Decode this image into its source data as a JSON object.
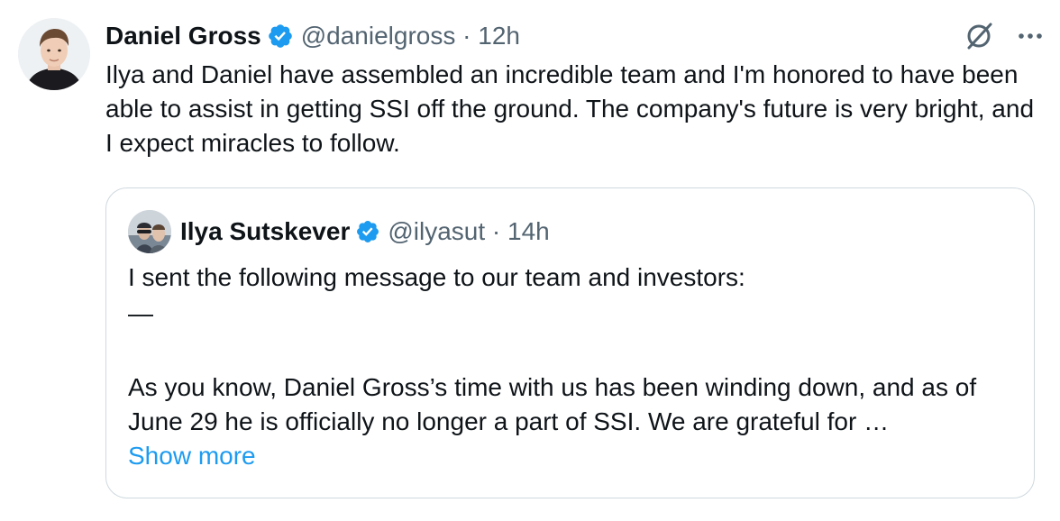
{
  "author": {
    "name": "Daniel Gross",
    "handle": "@danielgross",
    "time": "12h",
    "verified": true
  },
  "tweet": {
    "text": "Ilya and Daniel have assembled an incredible team and I'm honored to have been able to assist in getting SSI off the ground. The company's future is very bright, and I expect miracles to follow."
  },
  "quoted": {
    "name": "Ilya Sutskever",
    "handle": "@ilyasut",
    "time": "14h",
    "verified": true,
    "line1": "I sent the following message to our team and investors:",
    "dash": "—",
    "line2": "As you know, Daniel Gross’s time with us has been winding down, and as of June 29 he is officially no longer a part of SSI. We are grateful for …",
    "show_more": "Show more"
  },
  "separator": "·",
  "icons": {
    "verified": "verified-badge-icon",
    "grok": "grok-icon",
    "more": "more-icon"
  },
  "colors": {
    "verified": "#1d9bf0",
    "link": "#1d9bf0",
    "meta": "#536471",
    "text": "#0f1419",
    "border": "#cfd9de"
  }
}
